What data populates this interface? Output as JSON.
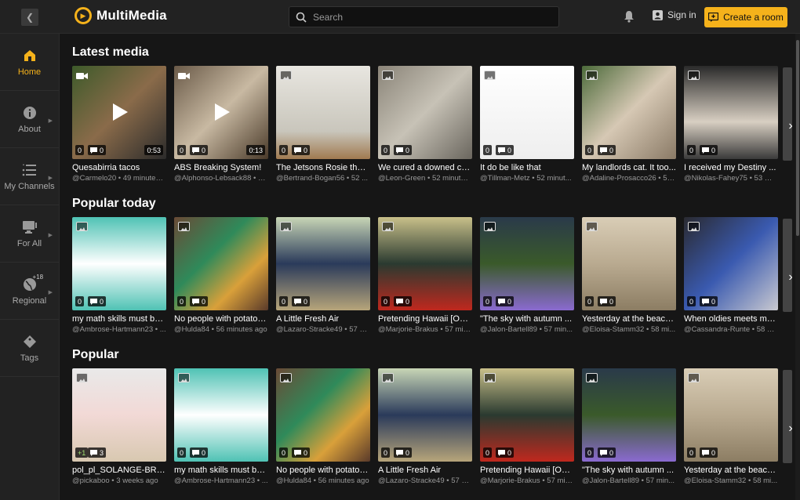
{
  "app": {
    "name": "MultiMedia",
    "accent": "#f5b21b"
  },
  "header": {
    "search_placeholder": "Search",
    "signin_label": "Sign in",
    "create_label": "Create a room"
  },
  "sidebar": {
    "items": [
      {
        "label": "Home",
        "icon": "home-icon",
        "active": true
      },
      {
        "label": "About",
        "icon": "info-icon"
      },
      {
        "label": "My Channels",
        "icon": "channels-icon"
      },
      {
        "label": "For All",
        "icon": "monitor-icon"
      },
      {
        "label": "Regional",
        "icon": "globe-icon",
        "badge": "+18"
      },
      {
        "label": "Tags",
        "icon": "tag-icon"
      }
    ]
  },
  "sections": [
    {
      "title": "Latest media",
      "cards": [
        {
          "title": "Quesabirria tacos",
          "meta": "@Carmelo20 • 49 minutes ...",
          "votes": "0",
          "comments": "0",
          "duration": "0:53",
          "type": "video"
        },
        {
          "title": "ABS Breaking System!",
          "meta": "@Alphonso-Lebsack88 • 4...",
          "votes": "0",
          "comments": "0",
          "duration": "0:13",
          "type": "video"
        },
        {
          "title": "The Jetsons Rosie the ...",
          "meta": "@Bertrand-Bogan56 • 52 ...",
          "votes": "0",
          "comments": "0",
          "type": "image"
        },
        {
          "title": "We cured a downed ca...",
          "meta": "@Leon-Green • 52 minutes...",
          "votes": "0",
          "comments": "0",
          "type": "image"
        },
        {
          "title": "It do be like that",
          "meta": "@Tillman-Metz • 52 minut...",
          "votes": "0",
          "comments": "0",
          "type": "image"
        },
        {
          "title": "My landlords cat. It too...",
          "meta": "@Adaline-Prosacco26 • 53...",
          "votes": "0",
          "comments": "0",
          "type": "image"
        },
        {
          "title": "I received my Destiny ...",
          "meta": "@Nikolas-Fahey75 • 53 mi...",
          "votes": "0",
          "comments": "0",
          "type": "image"
        }
      ]
    },
    {
      "title": "Popular today",
      "cards": [
        {
          "title": "my math skills must be...",
          "meta": "@Ambrose-Hartmann23 • ...",
          "votes": "0",
          "comments": "0",
          "type": "image"
        },
        {
          "title": "No people with potatoe...",
          "meta": "@Hulda84 • 56 minutes ago",
          "votes": "0",
          "comments": "0",
          "type": "image"
        },
        {
          "title": "A Little Fresh Air",
          "meta": "@Lazaro-Stracke49 • 57 m...",
          "votes": "0",
          "comments": "0",
          "type": "image"
        },
        {
          "title": "Pretending Hawaii [OC]...",
          "meta": "@Marjorie-Brakus • 57 min...",
          "votes": "0",
          "comments": "0",
          "type": "image"
        },
        {
          "title": "\"The sky with autumn ...",
          "meta": "@Jalon-Bartell89 • 57 min...",
          "votes": "0",
          "comments": "0",
          "type": "image"
        },
        {
          "title": "Yesterday at the beach...",
          "meta": "@Eloisa-Stamm32 • 58 mi...",
          "votes": "0",
          "comments": "0",
          "type": "image"
        },
        {
          "title": "When oldies meets mo...",
          "meta": "@Cassandra-Runte • 58 mi...",
          "votes": "0",
          "comments": "0",
          "type": "image"
        }
      ]
    },
    {
      "title": "Popular",
      "cards": [
        {
          "title": "pol_pl_SOLANGE-BRU...",
          "meta": "@pickaboo • 3 weeks ago",
          "votes": "+1",
          "comments": "3",
          "type": "image"
        },
        {
          "title": "my math skills must be...",
          "meta": "@Ambrose-Hartmann23 • ...",
          "votes": "0",
          "comments": "0",
          "type": "image"
        },
        {
          "title": "No people with potatoe...",
          "meta": "@Hulda84 • 56 minutes ago",
          "votes": "0",
          "comments": "0",
          "type": "image"
        },
        {
          "title": "A Little Fresh Air",
          "meta": "@Lazaro-Stracke49 • 57 m...",
          "votes": "0",
          "comments": "0",
          "type": "image"
        },
        {
          "title": "Pretending Hawaii [OC]...",
          "meta": "@Marjorie-Brakus • 57 min...",
          "votes": "0",
          "comments": "0",
          "type": "image"
        },
        {
          "title": "\"The sky with autumn ...",
          "meta": "@Jalon-Bartell89 • 57 min...",
          "votes": "0",
          "comments": "0",
          "type": "image"
        },
        {
          "title": "Yesterday at the beach...",
          "meta": "@Eloisa-Stamm32 • 58 mi...",
          "votes": "0",
          "comments": "0",
          "type": "image"
        }
      ]
    }
  ]
}
